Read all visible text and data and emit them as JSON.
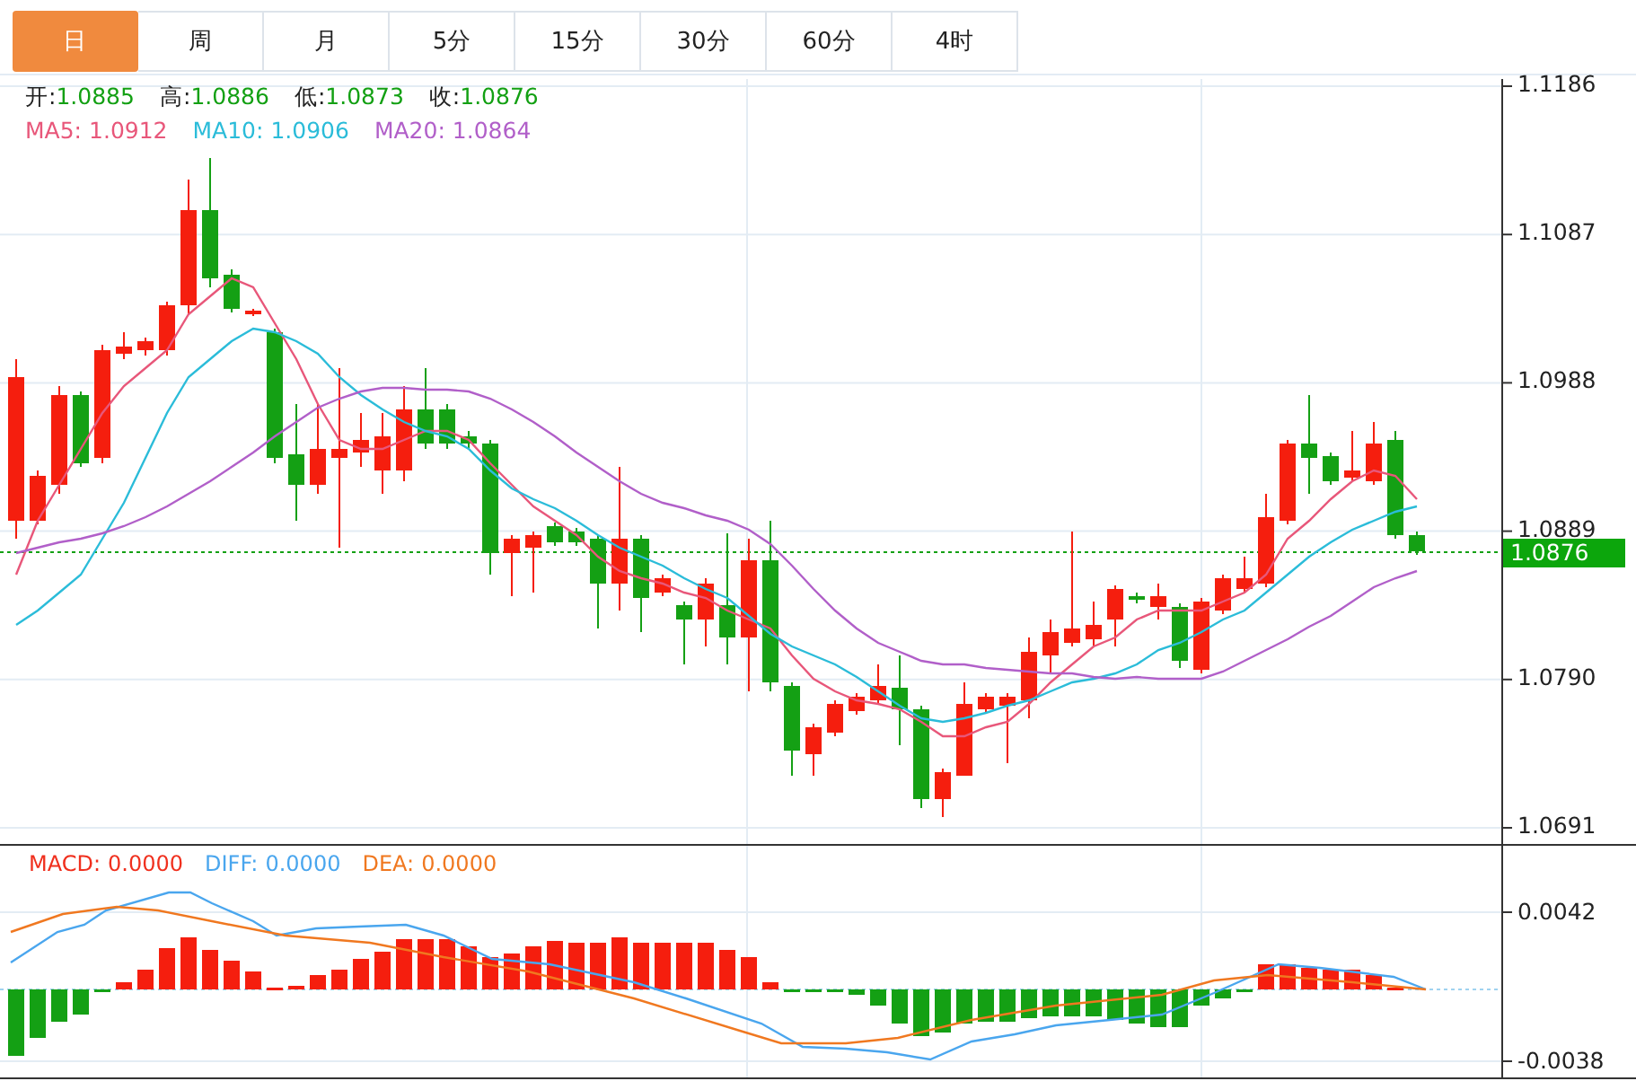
{
  "tabs": [
    {
      "label": "日",
      "selected": true
    },
    {
      "label": "周",
      "selected": false
    },
    {
      "label": "月",
      "selected": false
    },
    {
      "label": "5分",
      "selected": false
    },
    {
      "label": "15分",
      "selected": false
    },
    {
      "label": "30分",
      "selected": false
    },
    {
      "label": "60分",
      "selected": false
    },
    {
      "label": "4时",
      "selected": false
    }
  ],
  "quote": [
    {
      "label": "开:",
      "value": "1.0885"
    },
    {
      "label": "高:",
      "value": "1.0886"
    },
    {
      "label": "低:",
      "value": "1.0873"
    },
    {
      "label": "收:",
      "value": "1.0876"
    }
  ],
  "moving_averages": [
    {
      "label": "MA5:",
      "value": "1.0912",
      "color": "#e8577a"
    },
    {
      "label": "MA10:",
      "value": "1.0906",
      "color": "#2bbcd9"
    },
    {
      "label": "MA20:",
      "value": "1.0864",
      "color": "#b15fc9"
    }
  ],
  "price_axis": {
    "ticks": [
      "1.1186",
      "1.1087",
      "1.0988",
      "1.0889",
      "1.0790",
      "1.0691"
    ],
    "current_price": "1.0876"
  },
  "macd_legend": [
    {
      "label": "MACD:",
      "value": "0.0000",
      "color": "#f0301e"
    },
    {
      "label": "DIFF:",
      "value": "0.0000",
      "color": "#4aa6ee"
    },
    {
      "label": "DEA:",
      "value": "0.0000",
      "color": "#f07820"
    }
  ],
  "macd_axis": {
    "ticks": [
      "0.0042",
      "-0.0038"
    ]
  }
}
